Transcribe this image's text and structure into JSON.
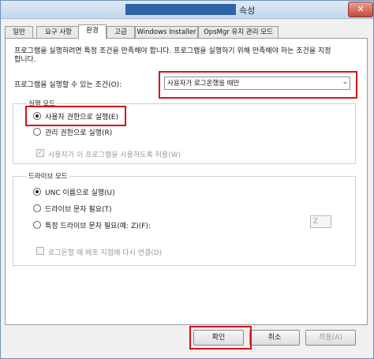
{
  "window": {
    "title": "속성",
    "close_glyph": "✕"
  },
  "tabs": [
    {
      "label": "일반"
    },
    {
      "label": "요구 사항"
    },
    {
      "label": "환경"
    },
    {
      "label": "고급"
    },
    {
      "label": "Windows Installer"
    },
    {
      "label": "OpsMgr 유지 관리 모드"
    }
  ],
  "active_tab": "환경",
  "description": {
    "line1": "프로그램을 실행하려면 특정 조건을 만족해야 합니다. 프로그램을 실행하기 위해 만족해야 하는 조건을 지정",
    "line2": "합니다."
  },
  "condition": {
    "label": "프로그램을 실행할 수 있는 조건(O):",
    "selected": "사용자가 로그온했을 때만"
  },
  "run_mode": {
    "group_label": "실행 모드",
    "options": [
      {
        "label": "사용자 권한으로 실행(E)",
        "selected": true
      },
      {
        "label": "관리 권한으로 실행(R)",
        "selected": false
      }
    ],
    "allow_interact": {
      "label": "사용자가 이 프로그램을 사용하도록 허용(W)",
      "checked": true,
      "enabled": false
    }
  },
  "drive_mode": {
    "group_label": "드라이브 모드",
    "options": [
      {
        "label": "UNC 이름으로 실행(U)",
        "selected": true
      },
      {
        "label": "드라이브 문자 필요(T)",
        "selected": false
      },
      {
        "label": "특정 드라이브 문자 필요(예: Z)(F):",
        "selected": false
      }
    ],
    "drive_letter": "Z",
    "reconnect": {
      "label": "로그온할 때 배포 지점에 다시 연결(D)",
      "checked": false,
      "enabled": false
    }
  },
  "buttons": {
    "ok": "확인",
    "cancel": "취소",
    "apply": "적용(A)"
  },
  "colors": {
    "highlight": "#d4131a",
    "title_redaction": "#2f64a8"
  }
}
